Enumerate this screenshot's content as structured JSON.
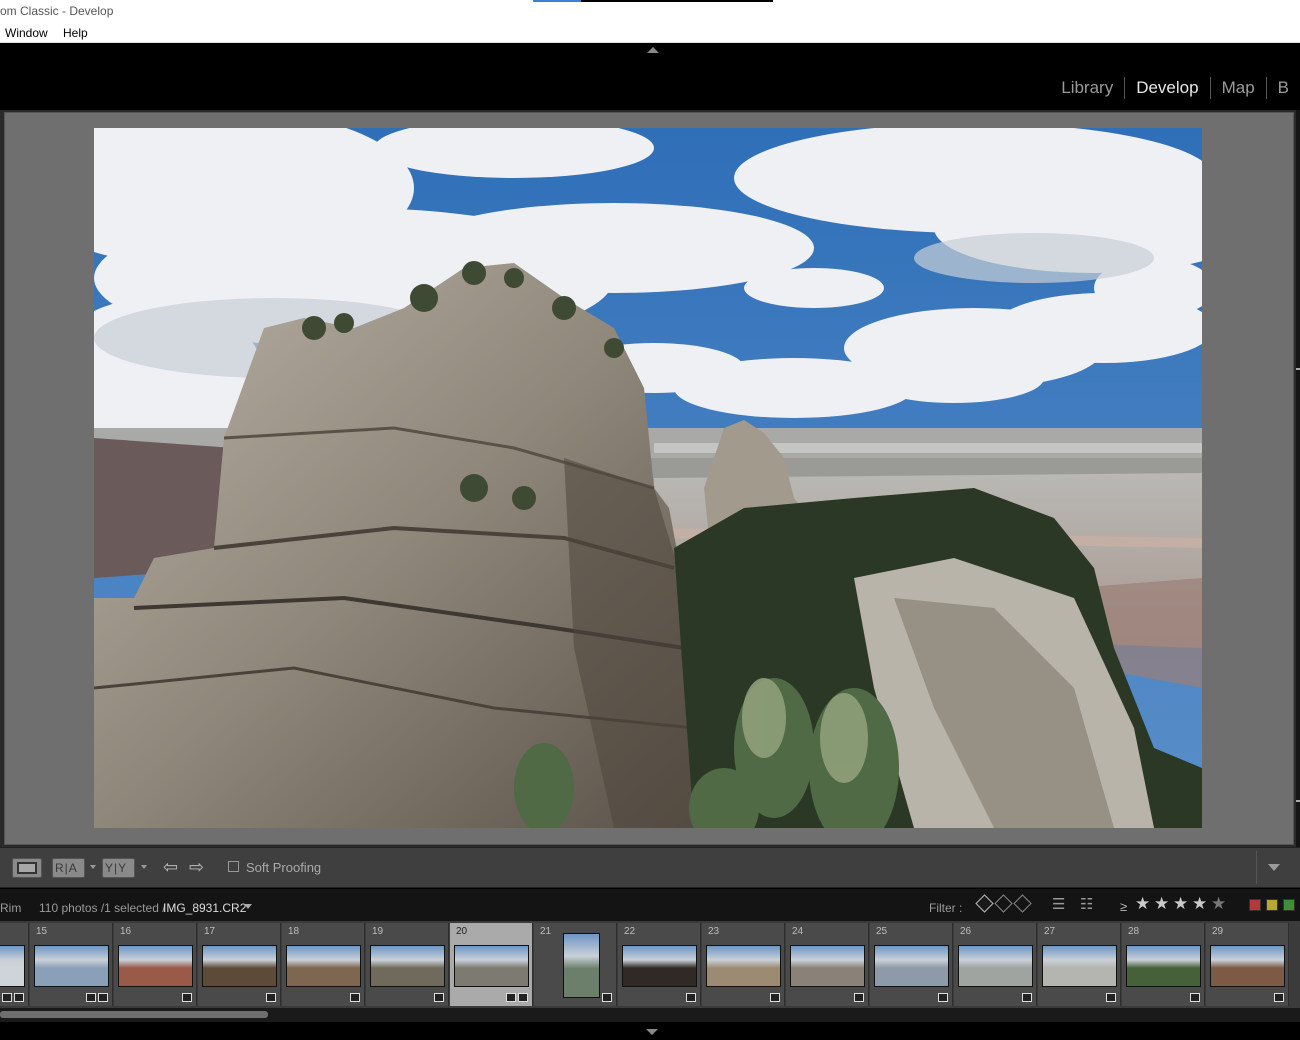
{
  "window": {
    "title": "om Classic - Develop",
    "progress_fraction": 0.2
  },
  "menubar": {
    "items": [
      "Window",
      "Help"
    ]
  },
  "modules": {
    "items": [
      "Library",
      "Develop",
      "Map",
      "B"
    ],
    "active": "Develop"
  },
  "toolbar": {
    "before_after_label": "R|A",
    "y_label": "Y|Y",
    "soft_proofing_label": "Soft Proofing",
    "soft_proofing_checked": false
  },
  "filmstrip": {
    "source": "Rim",
    "count_text": "110 photos /1 selected /",
    "filename": "IMG_8931.CR2",
    "filter_label": "Filter :",
    "rating_operator": "≥",
    "rating_stars": 4,
    "rating_max": 5,
    "label_colors": [
      "#b23a3a",
      "#b8a72e",
      "#3f8d3a"
    ],
    "cells": [
      {
        "num": "",
        "selected": false,
        "orientation": "landscape",
        "edited": true,
        "tone": "#cfd4d8"
      },
      {
        "num": "15",
        "selected": false,
        "orientation": "landscape",
        "edited": true,
        "tone": "#8aa0b8"
      },
      {
        "num": "16",
        "selected": false,
        "orientation": "landscape",
        "edited": false,
        "tone": "#9a5a4a"
      },
      {
        "num": "17",
        "selected": false,
        "orientation": "landscape",
        "edited": false,
        "tone": "#5e4a38"
      },
      {
        "num": "18",
        "selected": false,
        "orientation": "landscape",
        "edited": false,
        "tone": "#7e6650"
      },
      {
        "num": "19",
        "selected": false,
        "orientation": "landscape",
        "edited": false,
        "tone": "#6f6a5c"
      },
      {
        "num": "20",
        "selected": true,
        "orientation": "landscape",
        "edited": true,
        "tone": "#7d7a72"
      },
      {
        "num": "21",
        "selected": false,
        "orientation": "portrait",
        "edited": false,
        "tone": "#6b7f6a"
      },
      {
        "num": "22",
        "selected": false,
        "orientation": "landscape",
        "edited": false,
        "tone": "#2f2a24"
      },
      {
        "num": "23",
        "selected": false,
        "orientation": "landscape",
        "edited": false,
        "tone": "#9c8a72"
      },
      {
        "num": "24",
        "selected": false,
        "orientation": "landscape",
        "edited": false,
        "tone": "#8a8278"
      },
      {
        "num": "25",
        "selected": false,
        "orientation": "landscape",
        "edited": false,
        "tone": "#8e9aa8"
      },
      {
        "num": "26",
        "selected": false,
        "orientation": "landscape",
        "edited": false,
        "tone": "#a0a4a0"
      },
      {
        "num": "27",
        "selected": false,
        "orientation": "landscape",
        "edited": false,
        "tone": "#b4b4b0"
      },
      {
        "num": "28",
        "selected": false,
        "orientation": "landscape",
        "edited": false,
        "tone": "#46603a"
      },
      {
        "num": "29",
        "selected": false,
        "orientation": "landscape",
        "edited": false,
        "tone": "#7c5a44"
      }
    ]
  },
  "colors": {
    "panel": "#3f3f3f",
    "canvas": "#6f6f6f",
    "accent": "#3b7fd6"
  }
}
